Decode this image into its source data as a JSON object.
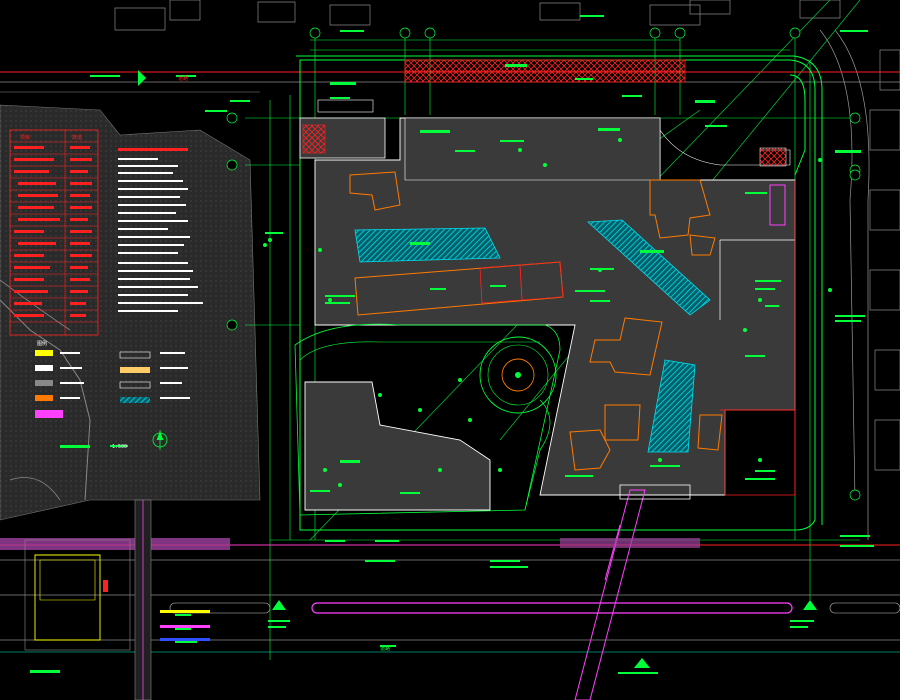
{
  "colors": {
    "background": "#000000",
    "site_line": "#00ff3a",
    "building_fill": "#3a3a3a",
    "building_outline": "#ffffff",
    "roof_outline": "#ff7a00",
    "hatch": "#00d7e8",
    "red_line": "#ff2020",
    "magenta": "#ff40ff",
    "gray_line": "#8a8a8a",
    "white_text": "#ffffff",
    "yellow": "#ffff00",
    "blue": "#3050ff"
  },
  "icons": {
    "north_arrow": "north-arrow-icon",
    "entrance_arrow": "entrance-triangle-icon"
  },
  "labels": {
    "table_legend": "图例",
    "plan_scale": "1:500",
    "road_north": "道路",
    "road_south": "道路",
    "stat_header": "项目",
    "stat_header_2": "数值"
  }
}
